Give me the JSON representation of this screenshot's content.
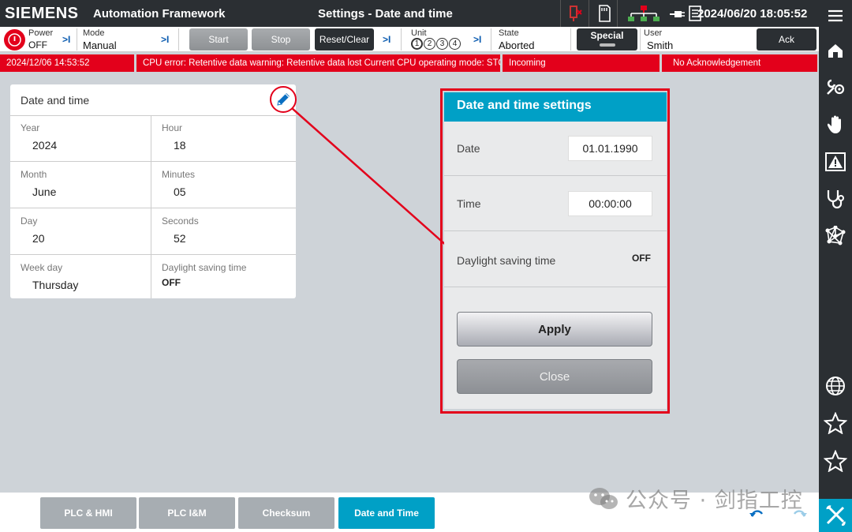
{
  "header": {
    "brand": "SIEMENS",
    "app_name": "Automation Framework",
    "page_title": "Settings - Date and time",
    "datetime": "2024/06/20  18:05:52",
    "icons": [
      "plc-status-icon",
      "sd-card-icon",
      "network-icon",
      "plug-icon",
      "document-icon"
    ]
  },
  "control": {
    "power_label": "Power",
    "power_value": "OFF",
    "mode_label": "Mode",
    "mode_value": "Manual",
    "start_label": "Start",
    "stop_label": "Stop",
    "reset_label": "Reset/Clear",
    "unit_label": "Unit",
    "units": [
      "1",
      "2",
      "3",
      "4"
    ],
    "state_label": "State",
    "state_value": "Aborted",
    "special_label": "Special",
    "user_label": "User",
    "user_value": "Smith",
    "ack_label": "Ack",
    "skip_glyph": ">I"
  },
  "alarm": {
    "timestamp": "2024/12/06  14:53:52",
    "message": "CPU error: Retentive data warning: Retentive data lost   Current CPU operating mode: STOP",
    "status": "Incoming",
    "ack_status": "No Acknowledgement"
  },
  "info_card": {
    "title": "Date and time",
    "fields": {
      "year": {
        "label": "Year",
        "value": "2024"
      },
      "hour": {
        "label": "Hour",
        "value": "18"
      },
      "month": {
        "label": "Month",
        "value": "June"
      },
      "minutes": {
        "label": "Minutes",
        "value": "05"
      },
      "day": {
        "label": "Day",
        "value": "20"
      },
      "seconds": {
        "label": "Seconds",
        "value": "52"
      },
      "weekday": {
        "label": "Week day",
        "value": "Thursday"
      },
      "dst": {
        "label": "Daylight saving time",
        "value": "OFF"
      }
    }
  },
  "dialog": {
    "title": "Date and time settings",
    "date_label": "Date",
    "date_value": "01.01.1990",
    "time_label": "Time",
    "time_value": "00:00:00",
    "dst_label": "Daylight saving time",
    "dst_value": "OFF",
    "apply_label": "Apply",
    "close_label": "Close"
  },
  "bottom_tabs": [
    "PLC & HMI",
    "PLC I&M",
    "Checksum",
    "Date and Time"
  ],
  "watermark": "公众号 · 剑指工控",
  "colors": {
    "accent": "#00a0c6",
    "alarm": "#e3001b",
    "dark_bar": "#2b2f33",
    "background": "#ced3d8"
  }
}
